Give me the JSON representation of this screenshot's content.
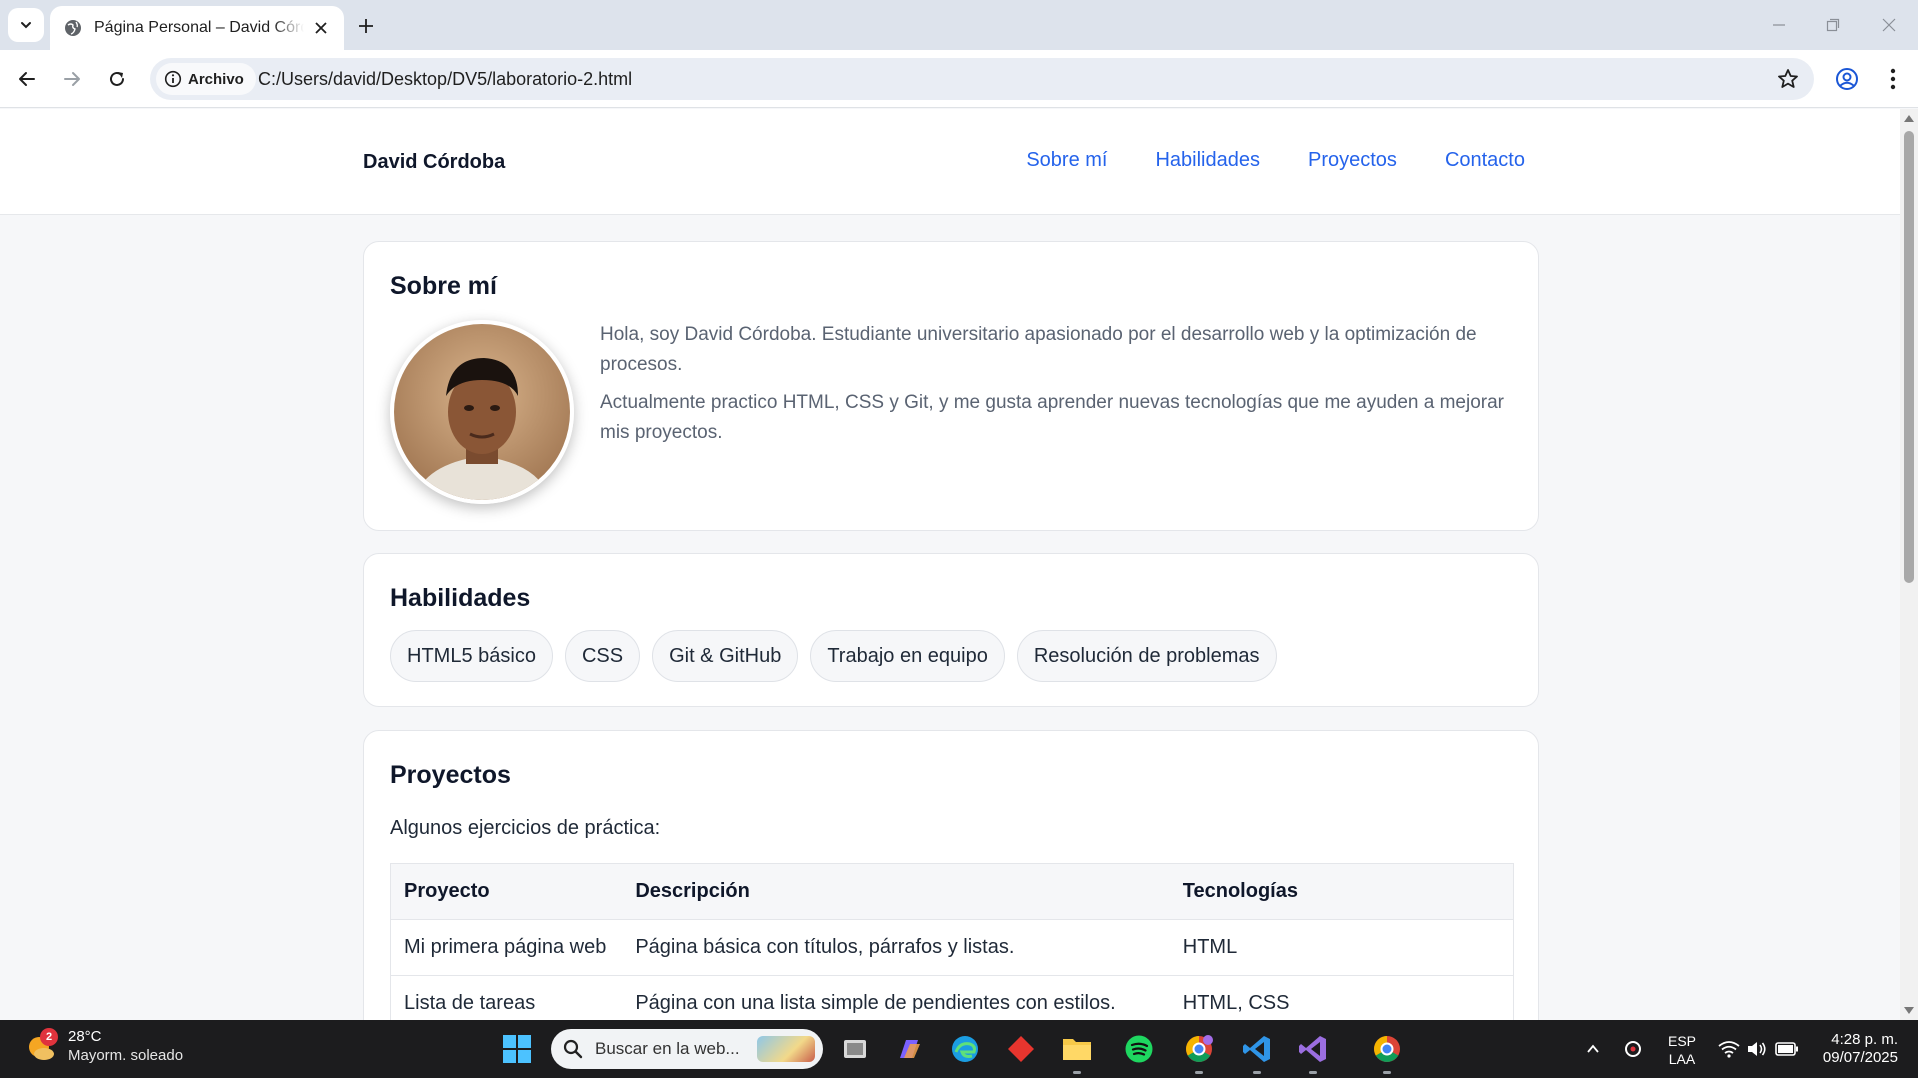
{
  "browser": {
    "tab_title": "Página Personal – David Córdoba",
    "site_chip": "Archivo",
    "url": "C:/Users/david/Desktop/DV5/laboratorio-2.html"
  },
  "site": {
    "brand": "David Córdoba",
    "nav": [
      "Sobre mí",
      "Habilidades",
      "Proyectos",
      "Contacto"
    ],
    "accent_color": "#2563eb"
  },
  "about": {
    "title": "Sobre mí",
    "paragraphs": [
      "Hola, soy David Córdoba. Estudiante universitario apasionado por el desarrollo web y la optimización de procesos.",
      "Actualmente practico HTML, CSS y Git, y me gusta aprender nuevas tecnologías que me ayuden a mejorar mis proyectos."
    ]
  },
  "skills": {
    "title": "Habilidades",
    "items": [
      "HTML5 básico",
      "CSS",
      "Git & GitHub",
      "Trabajo en equipo",
      "Resolución de problemas"
    ]
  },
  "projects": {
    "title": "Proyectos",
    "intro": "Algunos ejercicios de práctica:",
    "headers": [
      "Proyecto",
      "Descripción",
      "Tecnologías"
    ],
    "rows": [
      [
        "Mi primera página web",
        "Página básica con títulos, párrafos y listas.",
        "HTML"
      ],
      [
        "Lista de tareas",
        "Página con una lista simple de pendientes con estilos.",
        "HTML, CSS"
      ]
    ]
  },
  "taskbar": {
    "weather_badge": "2",
    "weather_temp": "28°C",
    "weather_condition": "Mayorm. soleado",
    "search_placeholder": "Buscar en la web...",
    "lang_line1": "ESP",
    "lang_line2": "LAA",
    "time": "4:28 p. m.",
    "date": "09/07/2025"
  }
}
